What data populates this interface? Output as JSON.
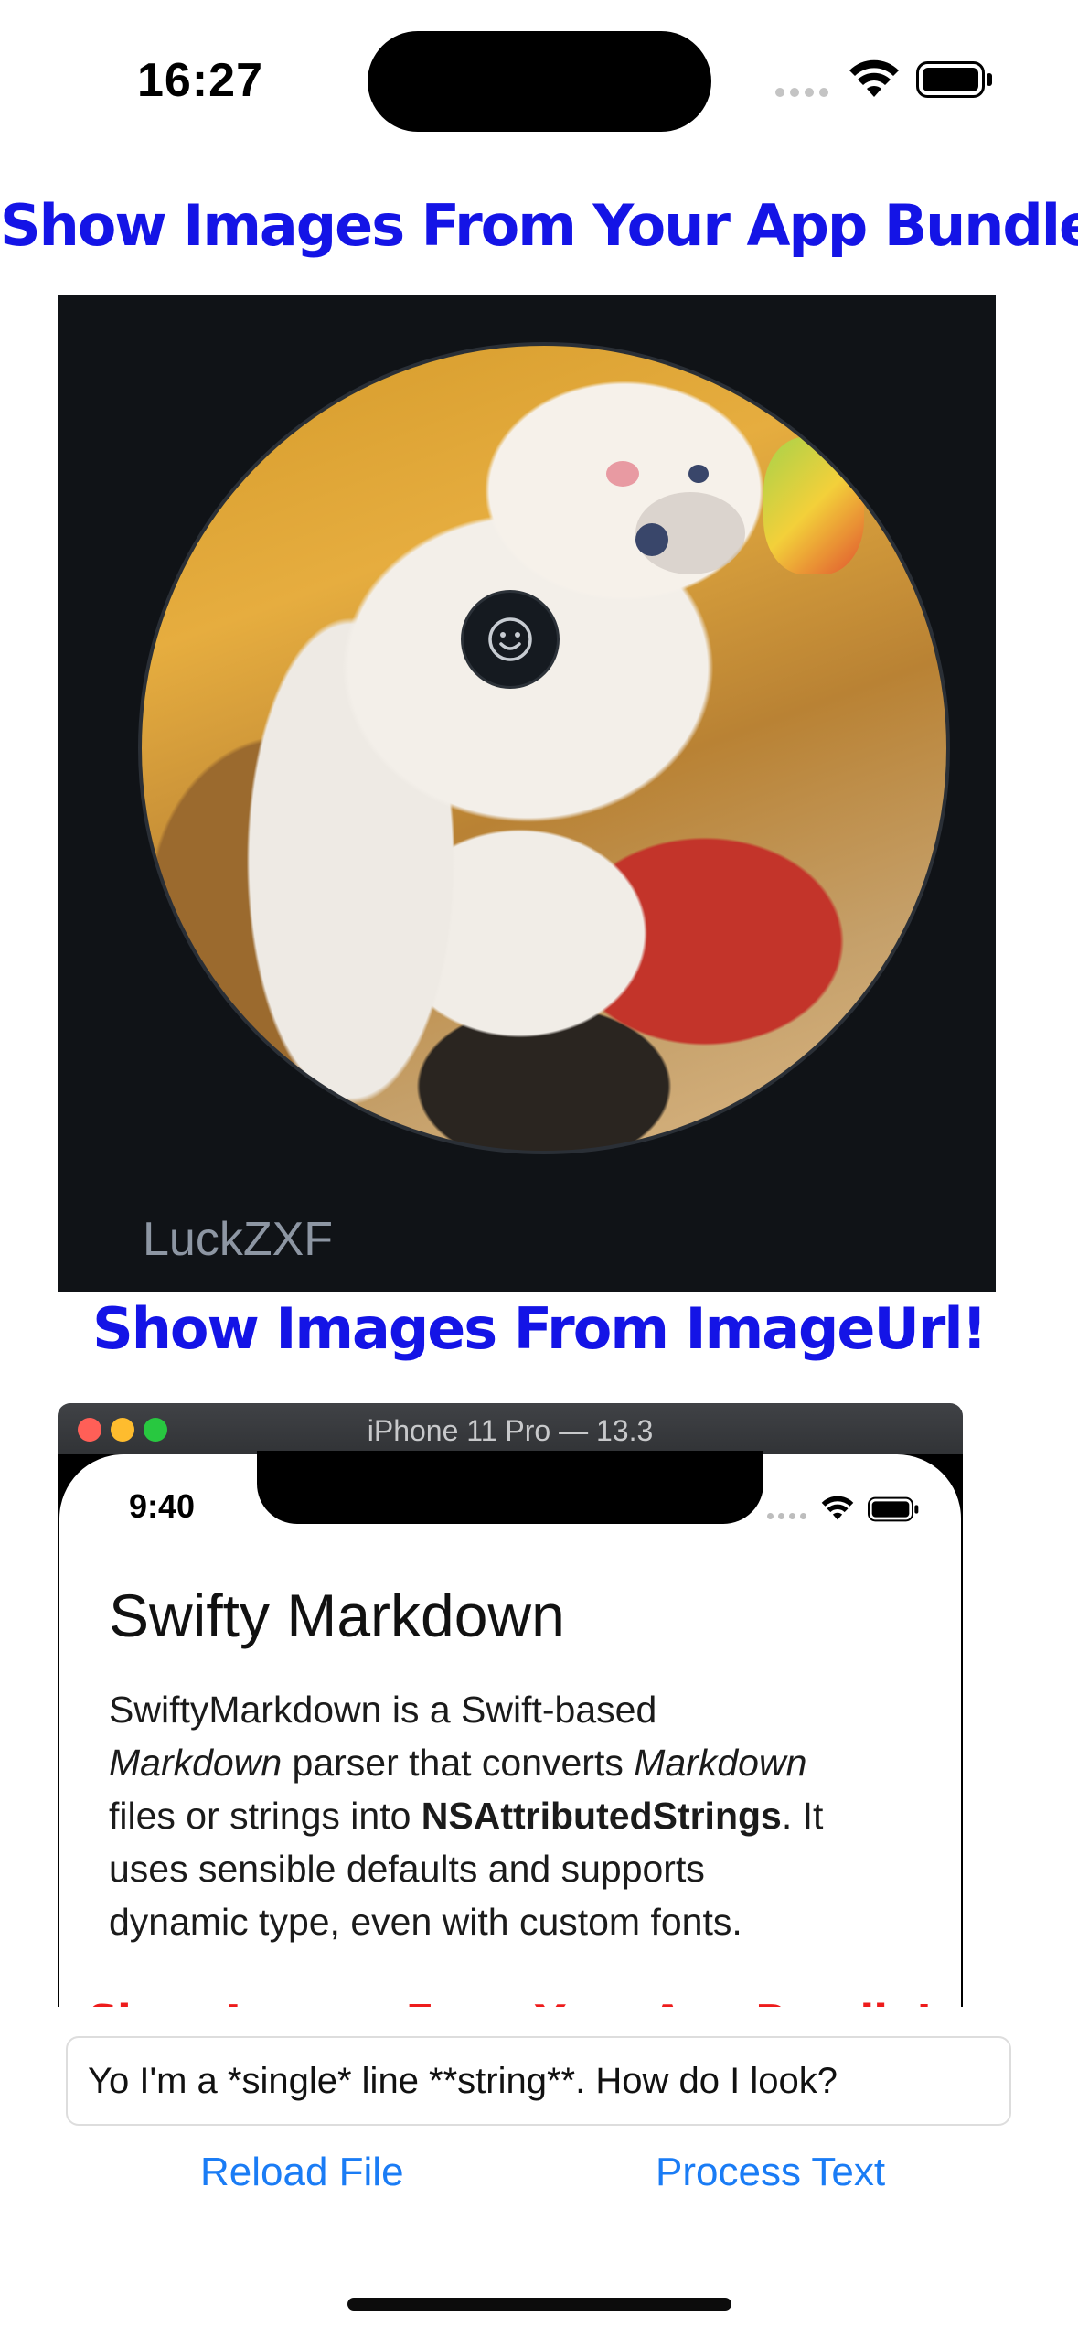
{
  "status_bar": {
    "time": "16:27"
  },
  "headings": {
    "bundle": "Show Images From Your App Bundle!",
    "url": "Show Images From ImageUrl!"
  },
  "bundle_image": {
    "caption": "LuckZXF",
    "icon": "smiley-icon"
  },
  "url_image": {
    "window_title": "iPhone 11 Pro — 13.3",
    "sim_time": "9:40",
    "title": "Swifty Markdown",
    "body": {
      "p1": "SwiftyMarkdown is a Swift-based",
      "p2_em1": "Markdown",
      "p2_mid": " parser that converts ",
      "p2_em2": "Markdown",
      "p3_pre": "files or strings into ",
      "p3_strong": "NSAttributedStrings",
      "p3_post": ". It",
      "p4": "uses sensible defaults and supports",
      "p5": "dynamic type, even with custom fonts."
    },
    "cut_heading": "Show Images From Your App Bundle!"
  },
  "input": {
    "value": "Yo I'm a *single* line **string**. How do I look?"
  },
  "buttons": {
    "reload": "Reload File",
    "process": "Process Text"
  },
  "colors": {
    "heading_blue": "#1414e6",
    "link_blue": "#1a7cf5",
    "heading_red": "#ee1c1c"
  }
}
